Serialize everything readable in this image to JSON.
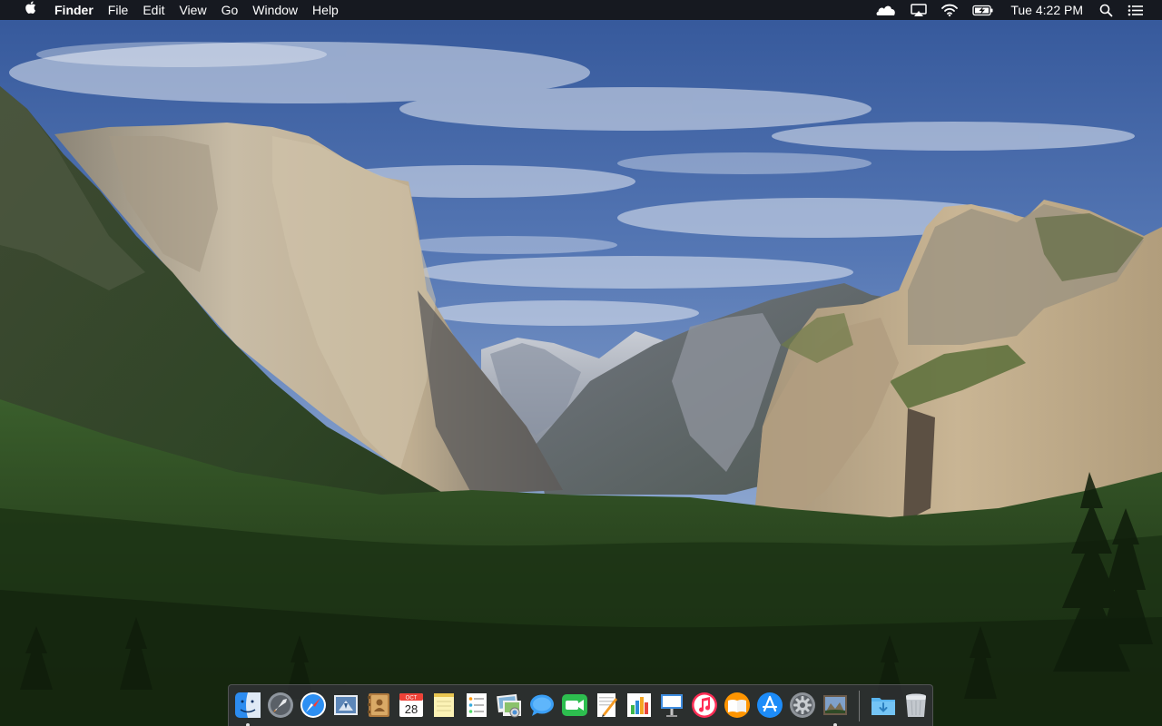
{
  "menubar": {
    "apple_icon": "apple-icon",
    "app_name": "Finder",
    "menus": [
      "File",
      "Edit",
      "View",
      "Go",
      "Window",
      "Help"
    ],
    "status_icons": [
      "cloud-icon",
      "airplay-icon",
      "wifi-icon",
      "battery-charging-icon"
    ],
    "clock": "Tue 4:22 PM",
    "spotlight_icon": "search-icon",
    "notification_icon": "list-icon"
  },
  "wallpaper": {
    "scene": "mountain-valley-wallpaper"
  },
  "dock": {
    "apps": [
      {
        "name": "finder",
        "icon": "finder-icon",
        "running": true
      },
      {
        "name": "launchpad",
        "icon": "launchpad-icon",
        "running": false
      },
      {
        "name": "safari",
        "icon": "safari-icon",
        "running": false
      },
      {
        "name": "mail",
        "icon": "mail-icon",
        "running": false
      },
      {
        "name": "contacts",
        "icon": "contacts-icon",
        "running": false
      },
      {
        "name": "calendar",
        "icon": "calendar-icon",
        "running": false,
        "month": "OCT",
        "day": "28"
      },
      {
        "name": "notes",
        "icon": "notes-icon",
        "running": false
      },
      {
        "name": "reminders",
        "icon": "reminders-icon",
        "running": false
      },
      {
        "name": "photos",
        "icon": "photos-icon",
        "running": false
      },
      {
        "name": "messages",
        "icon": "messages-icon",
        "running": false
      },
      {
        "name": "facetime",
        "icon": "facetime-icon",
        "running": false
      },
      {
        "name": "pages",
        "icon": "pages-icon",
        "running": false
      },
      {
        "name": "numbers",
        "icon": "numbers-icon",
        "running": false
      },
      {
        "name": "keynote",
        "icon": "keynote-icon",
        "running": false
      },
      {
        "name": "itunes",
        "icon": "itunes-icon",
        "running": false
      },
      {
        "name": "ibooks",
        "icon": "ibooks-icon",
        "running": false
      },
      {
        "name": "app-store",
        "icon": "app-store-icon",
        "running": false
      },
      {
        "name": "system-preferences",
        "icon": "gear-icon",
        "running": false
      },
      {
        "name": "image-viewer",
        "icon": "image-viewer-icon",
        "running": true
      }
    ],
    "stacks": [
      {
        "name": "downloads",
        "icon": "downloads-folder-icon"
      },
      {
        "name": "trash",
        "icon": "trash-icon"
      }
    ]
  },
  "colors": {
    "menubar_bg": "#141416",
    "sky_top": "#34579a",
    "sky_bottom": "#a9bcd9",
    "forest": "#24401f",
    "cliff": "#b8a98d"
  }
}
